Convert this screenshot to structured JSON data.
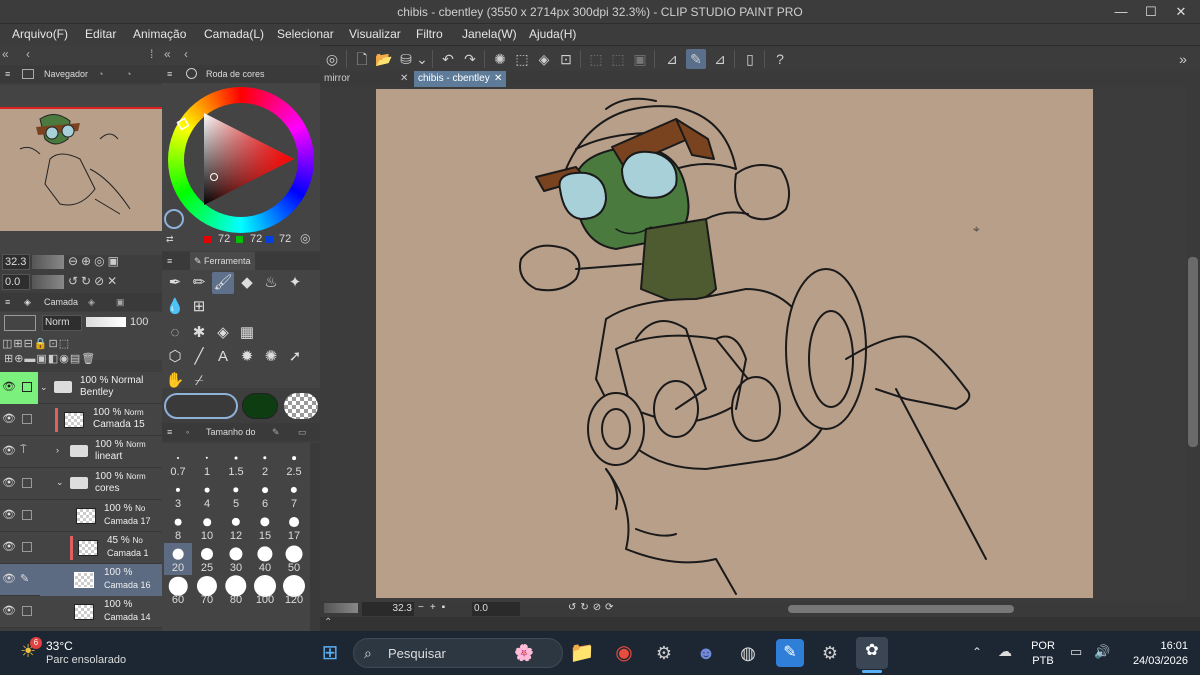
{
  "window": {
    "title": "chibis - cbentley (3550 x 2714px 300dpi 32.3%)  - CLIP STUDIO PAINT PRO",
    "minimize": "—",
    "maximize": "☐",
    "close": "✕"
  },
  "menu": [
    "Arquivo(F)",
    "Editar",
    "Animação",
    "Camada(L)",
    "Selecionar",
    "Visualizar",
    "Filtro",
    "Janela(W)",
    "Ajuda(H)"
  ],
  "navigator": {
    "label": "Navegador",
    "zoom": "32.3",
    "rotation": "0.0"
  },
  "color_wheel": {
    "label": "Roda de cores",
    "r": "72",
    "g": "72",
    "b": "72",
    "main_color": "#3a3a3a",
    "sub_color": "#ffffff"
  },
  "tool_panel": {
    "label": "Ferramenta"
  },
  "brush_size": {
    "label": "Tamanho do",
    "sizes": [
      "0.7",
      "1",
      "1.5",
      "2",
      "2.5",
      "3",
      "4",
      "5",
      "6",
      "7",
      "8",
      "10",
      "12",
      "15",
      "17",
      "20",
      "25",
      "30",
      "40",
      "50",
      "60",
      "70",
      "80",
      "100",
      "120"
    ],
    "selected": "20"
  },
  "layer_panel": {
    "label": "Camada",
    "blend": "Norm",
    "opacity": "100",
    "layers": [
      {
        "pct": "100 %",
        "mode": "Normal",
        "name": "Bentley",
        "kind": "folder"
      },
      {
        "pct": "100 %",
        "mode": "Norm",
        "name": "Camada 15",
        "kind": "raster"
      },
      {
        "pct": "100 %",
        "mode": "Norm",
        "name": "lineart",
        "kind": "folder"
      },
      {
        "pct": "100 %",
        "mode": "Norm",
        "name": "cores",
        "kind": "folder"
      },
      {
        "pct": "100 %",
        "mode": "No",
        "name": "Camada 17",
        "kind": "raster"
      },
      {
        "pct": "45 %",
        "mode": "No",
        "name": "Camada 1",
        "kind": "raster"
      },
      {
        "pct": "100 %",
        "mode": "",
        "name": "Camada 16",
        "kind": "raster"
      },
      {
        "pct": "100 %",
        "mode": "",
        "name": "Camada 14",
        "kind": "raster"
      }
    ]
  },
  "tabs": [
    {
      "label": "mirror"
    },
    {
      "label": "chibis - cbentley"
    }
  ],
  "status": {
    "zoom": "32.3",
    "rotation": "0.0"
  },
  "taskbar": {
    "weather_temp": "33°C",
    "weather_desc": "Parc ensolarado",
    "weather_badge": "6",
    "search_placeholder": "Pesquisar",
    "lang1": "POR",
    "lang2": "PTB",
    "time": "16:01",
    "date": "24/03/2026"
  },
  "colors": {
    "canvas_bg": "#b89f8a",
    "accent": "#5e7c99",
    "turtle_skin": "#4b7a3f",
    "shirt": "#4e5a2f",
    "goggles": "#a8d0d8",
    "strap": "#7a4320"
  }
}
